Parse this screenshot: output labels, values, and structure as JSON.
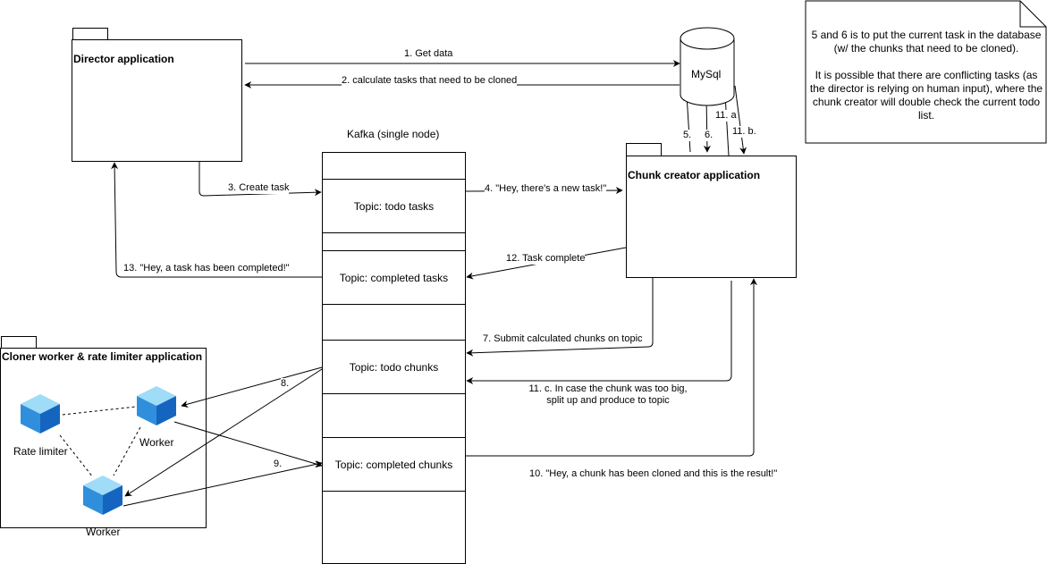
{
  "diagram": {
    "director": {
      "title": "Director application"
    },
    "chunk_creator": {
      "title": "Chunk creator application"
    },
    "cloner": {
      "title": "Cloner worker & rate limiter application",
      "rate_limiter_label": "Rate limiter",
      "worker_top_label": "Worker",
      "worker_bottom_label": "Worker"
    },
    "mysql": {
      "label": "MySql"
    },
    "kafka": {
      "title": "Kafka (single node)",
      "topics": {
        "todo_tasks": "Topic: todo tasks",
        "completed_tasks": "Topic: completed tasks",
        "todo_chunks": "Topic: todo chunks",
        "completed_chunks": "Topic: completed chunks"
      }
    },
    "note": {
      "line1": "5 and 6 is to put the current task in the database (w/ the chunks that need to be cloned).",
      "line2": "It is possible that there are conflicting tasks (as the director is relying on human input), where the chunk creator will double check the current todo list."
    },
    "edges": {
      "e1": "1. Get data",
      "e2": "2. calculate tasks that need to be cloned",
      "e3": "3. Create task",
      "e4": "4. \"Hey, there's a new task!\"",
      "e5": "5.",
      "e6": "6.",
      "e7": "7. Submit calculated chunks on topic",
      "e8": "8.",
      "e9": "9.",
      "e10": "10. \"Hey, a chunk has been cloned and this is the result!\"",
      "e11a": "11. a",
      "e11b": "11. b.",
      "e11c_line1": "11. c. In case the chunk was too big,",
      "e11c_line2": "split up and produce to topic",
      "e12": "12. Task complete",
      "e13": "13. \"Hey, a task has been completed!\""
    },
    "colors": {
      "stroke": "#000000",
      "cube_top": "#9fdcf7",
      "cube_left": "#2f8fdc",
      "cube_right": "#1565c0"
    }
  }
}
